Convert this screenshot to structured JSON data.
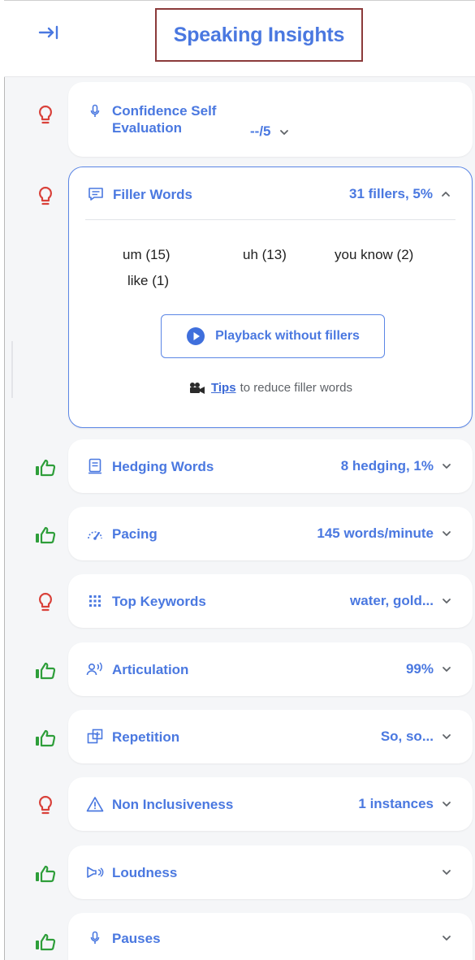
{
  "header": {
    "title": "Speaking Insights",
    "collapse_icon": "collapse-right-icon"
  },
  "colors": {
    "accent": "#4a78e0",
    "good": "#2e9e3a",
    "tip": "#d9413a",
    "title_border": "#8b3a3a"
  },
  "insights": [
    {
      "label": "Confidence Self Evaluation",
      "value": "--/5",
      "status": "tip",
      "icon": "microphone-icon"
    },
    {
      "label": "Filler Words",
      "value": "31 fillers, 5%",
      "status": "tip",
      "icon": "message-icon",
      "expanded": true
    },
    {
      "label": "Hedging Words",
      "value": "8 hedging, 1%",
      "status": "good",
      "icon": "document-icon"
    },
    {
      "label": "Pacing",
      "value": "145 words/minute",
      "status": "good",
      "icon": "speedometer-icon"
    },
    {
      "label": "Top Keywords",
      "value": "water, gold...",
      "status": "tip",
      "icon": "grid-icon"
    },
    {
      "label": "Articulation",
      "value": "99%",
      "status": "good",
      "icon": "speaker-person-icon"
    },
    {
      "label": "Repetition",
      "value": "So, so...",
      "status": "good",
      "icon": "repeat-squares-icon"
    },
    {
      "label": "Non Inclusiveness",
      "value": "1 instances",
      "status": "tip",
      "icon": "warning-icon"
    },
    {
      "label": "Loudness",
      "value": "",
      "status": "good",
      "icon": "megaphone-icon"
    },
    {
      "label": "Pauses",
      "value": "",
      "status": "good",
      "icon": "microphone-icon"
    }
  ],
  "filler_detail": {
    "items": [
      "um (15)",
      "uh (13)",
      "you know (2)",
      "like (1)"
    ],
    "playback_label": "Playback without fillers",
    "tips_link": "Tips",
    "tips_text": "to reduce filler words"
  }
}
